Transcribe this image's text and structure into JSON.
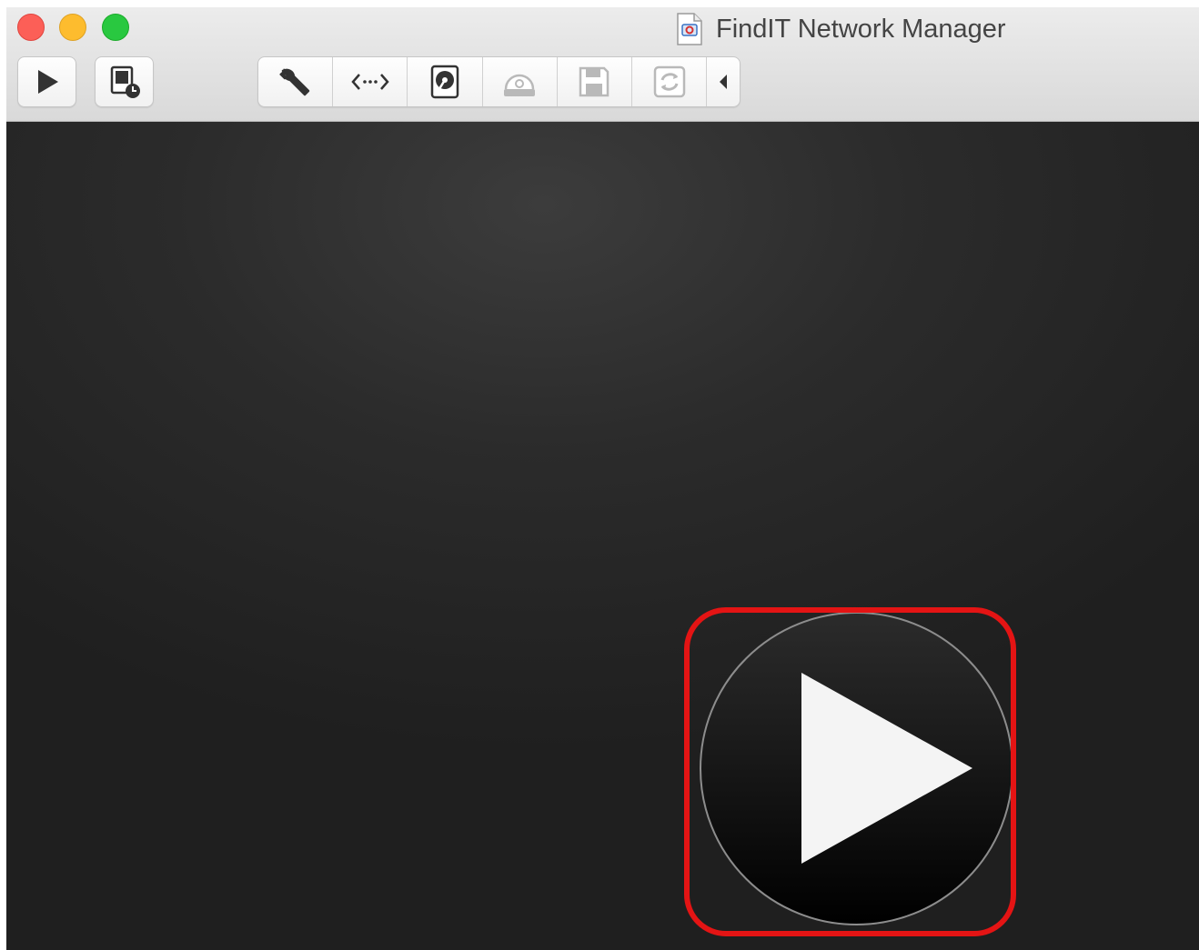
{
  "window": {
    "title": "FindIT Network Manager",
    "traffic_lights": {
      "close_color": "#fc5f57",
      "minimize_color": "#fdbc2e",
      "maximize_color": "#29c840"
    }
  },
  "toolbar": {
    "left_buttons": [
      {
        "name": "start-button",
        "icon": "play-icon"
      },
      {
        "name": "snapshot-button",
        "icon": "snapshot-clock-icon"
      }
    ],
    "segmented_buttons": [
      {
        "name": "settings-button",
        "icon": "wrench-icon"
      },
      {
        "name": "network-button",
        "icon": "network-arrows-icon"
      },
      {
        "name": "hard-disk-button",
        "icon": "hard-disk-icon"
      },
      {
        "name": "cd-dvd-button",
        "icon": "disc-drive-icon"
      },
      {
        "name": "floppy-button",
        "icon": "floppy-disk-icon"
      },
      {
        "name": "usb-sync-button",
        "icon": "sync-icon"
      },
      {
        "name": "collapse-button",
        "icon": "chevron-left-icon"
      }
    ]
  },
  "content": {
    "background_color": "#2b2b2b",
    "center_button": {
      "icon": "big-play-icon",
      "highlight_color": "#e41414"
    }
  }
}
